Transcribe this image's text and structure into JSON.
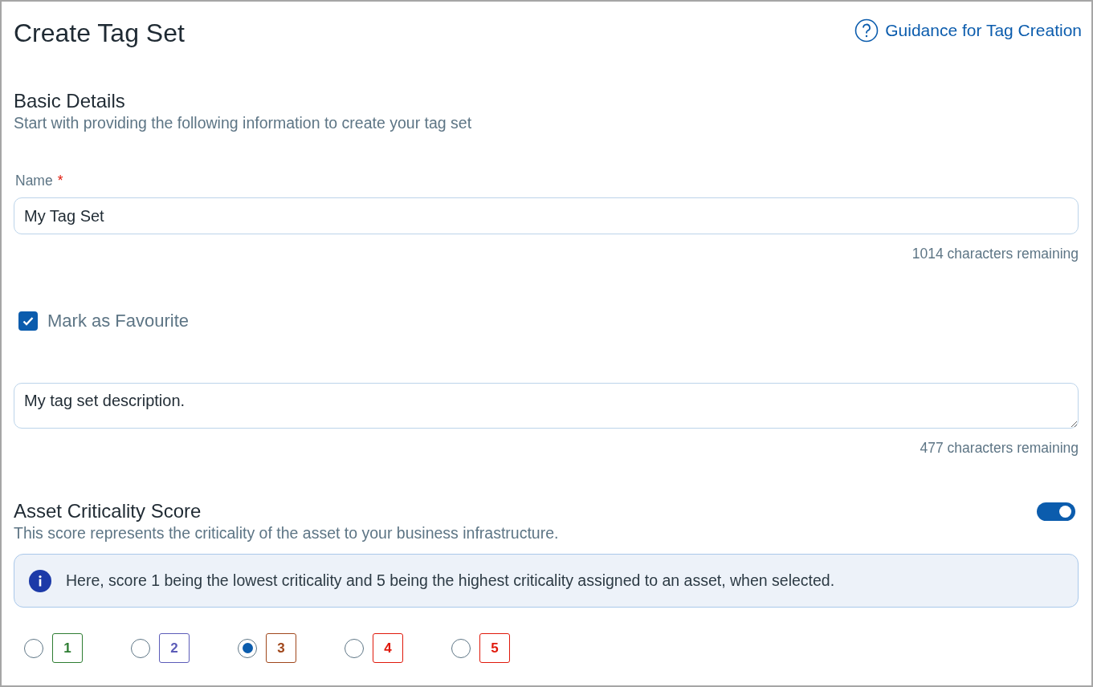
{
  "title": "Create Tag Set",
  "guidance_link": "Guidance for Tag Creation",
  "basic_details": {
    "heading": "Basic Details",
    "subtitle": "Start with providing the following information to create your tag set"
  },
  "name_field": {
    "label": "Name",
    "required_mark": "*",
    "value": "My Tag Set",
    "counter": "1014 characters remaining"
  },
  "favourite": {
    "label": "Mark as Favourite",
    "checked": true
  },
  "description_field": {
    "value": "My tag set description.",
    "counter": "477 characters remaining"
  },
  "criticality": {
    "heading": "Asset Criticality Score",
    "on": true,
    "subtitle": "This score represents the criticality of the asset to your business infrastructure.",
    "info": "Here, score 1 being the lowest criticality and 5 being the highest criticality assigned to an asset, when selected.",
    "scores": [
      {
        "label": "1",
        "color": "#2e7d32",
        "selected": false
      },
      {
        "label": "2",
        "color": "#5c5cb8",
        "selected": false
      },
      {
        "label": "3",
        "color": "#a0471b",
        "selected": true
      },
      {
        "label": "4",
        "color": "#e0190b",
        "selected": false
      },
      {
        "label": "5",
        "color": "#e0190b",
        "selected": false
      }
    ]
  }
}
